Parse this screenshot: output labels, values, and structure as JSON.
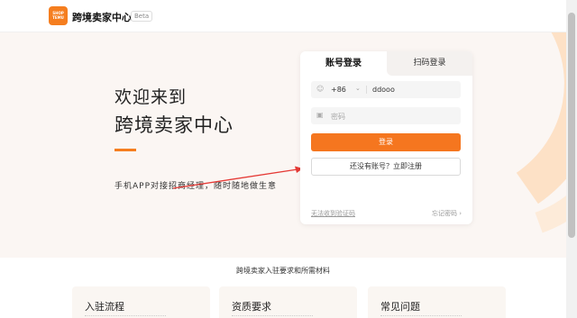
{
  "header": {
    "logo_text": "SHOP TEMU",
    "brand": "跨境卖家中心",
    "badge": "Beta"
  },
  "hero": {
    "welcome_line1": "欢迎来到",
    "welcome_line2": "跨境卖家中心",
    "tagline": "手机APP对接招商经理，随时随地做生意"
  },
  "login": {
    "tab_account": "账号登录",
    "tab_scan": "扫码登录",
    "country_code": "+86",
    "phone_value": "ddooo",
    "password_placeholder": "密码",
    "login_button": "登录",
    "register_button": "还没有账号？立即注册",
    "no_code_link": "无法收到验证码",
    "forgot_link": "忘记密码",
    "forgot_chevron": "›"
  },
  "requirements": {
    "section_title": "跨境卖家入驻要求和所需材料",
    "cards": [
      {
        "title": "入驻流程"
      },
      {
        "title": "资质要求"
      },
      {
        "title": "常见问题"
      }
    ]
  },
  "colors": {
    "accent": "#f5761f"
  }
}
